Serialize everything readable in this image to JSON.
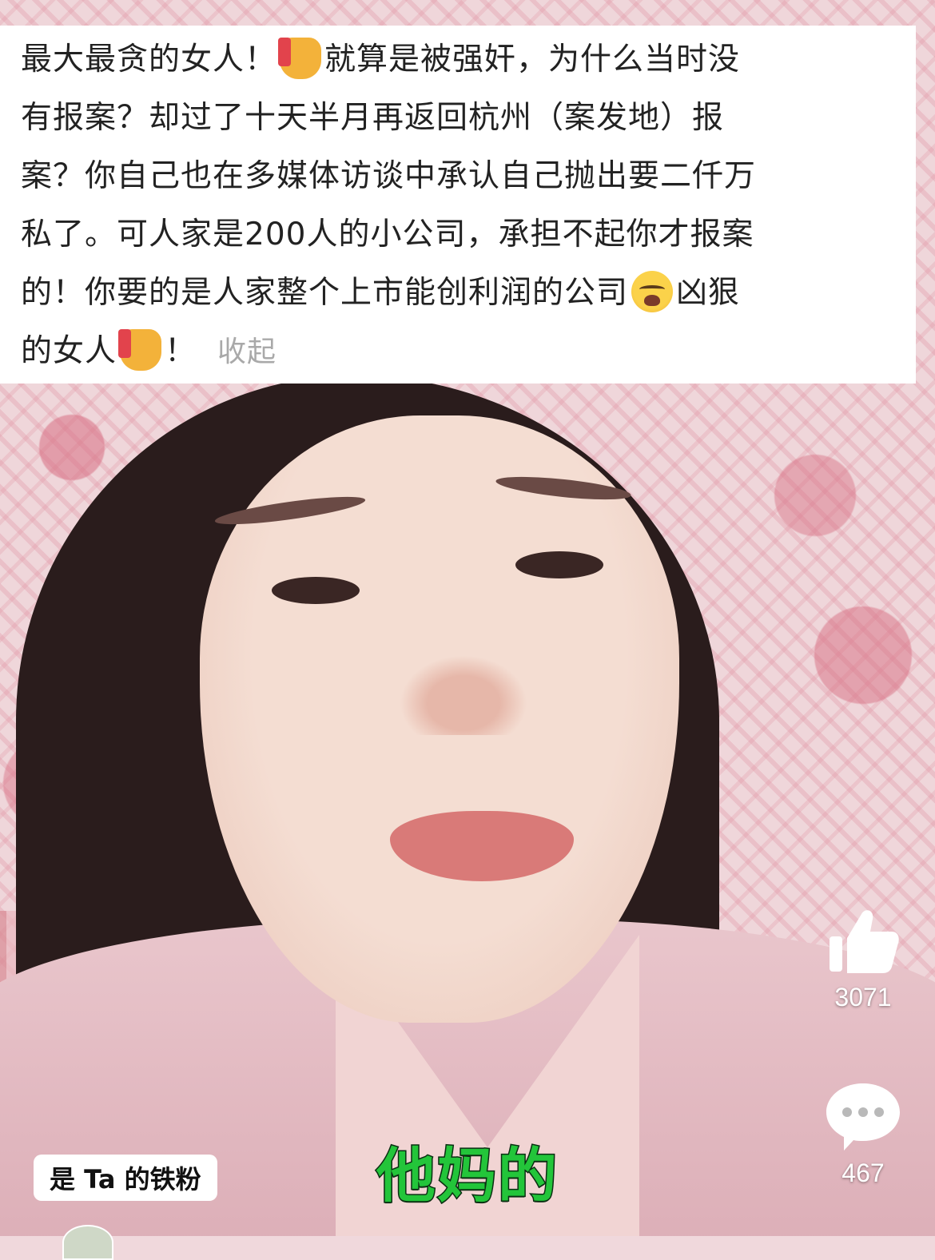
{
  "comment": {
    "line1_a": "最大最贪的女人！",
    "line1_b": "就算是被强奸，为什么当时没",
    "line2": "有报案？却过了十天半月再返回杭州（案发地）报",
    "line3": "案？你自己也在多媒体访谈中承认自己抛出要二仟万",
    "line4": "私了。可人家是200人的小公司，承担不起你才报案",
    "line5_a": "的！你要的是人家整个上市能创利润的公司",
    "line5_b": "凶狠",
    "line6_a": "的女人",
    "line6_b": "！",
    "collapse_label": "收起",
    "emoji_names": [
      "thumbs-down",
      "crying-face",
      "thumbs-down"
    ]
  },
  "actions": {
    "like_count": "3071",
    "comment_count": "467"
  },
  "subtitle": "他妈的",
  "fan_badge": "是 Ta 的铁粉",
  "colors": {
    "subtitle": "#23c53a",
    "card_background": "#ffffff",
    "collapse_link": "#a9a9a9"
  }
}
